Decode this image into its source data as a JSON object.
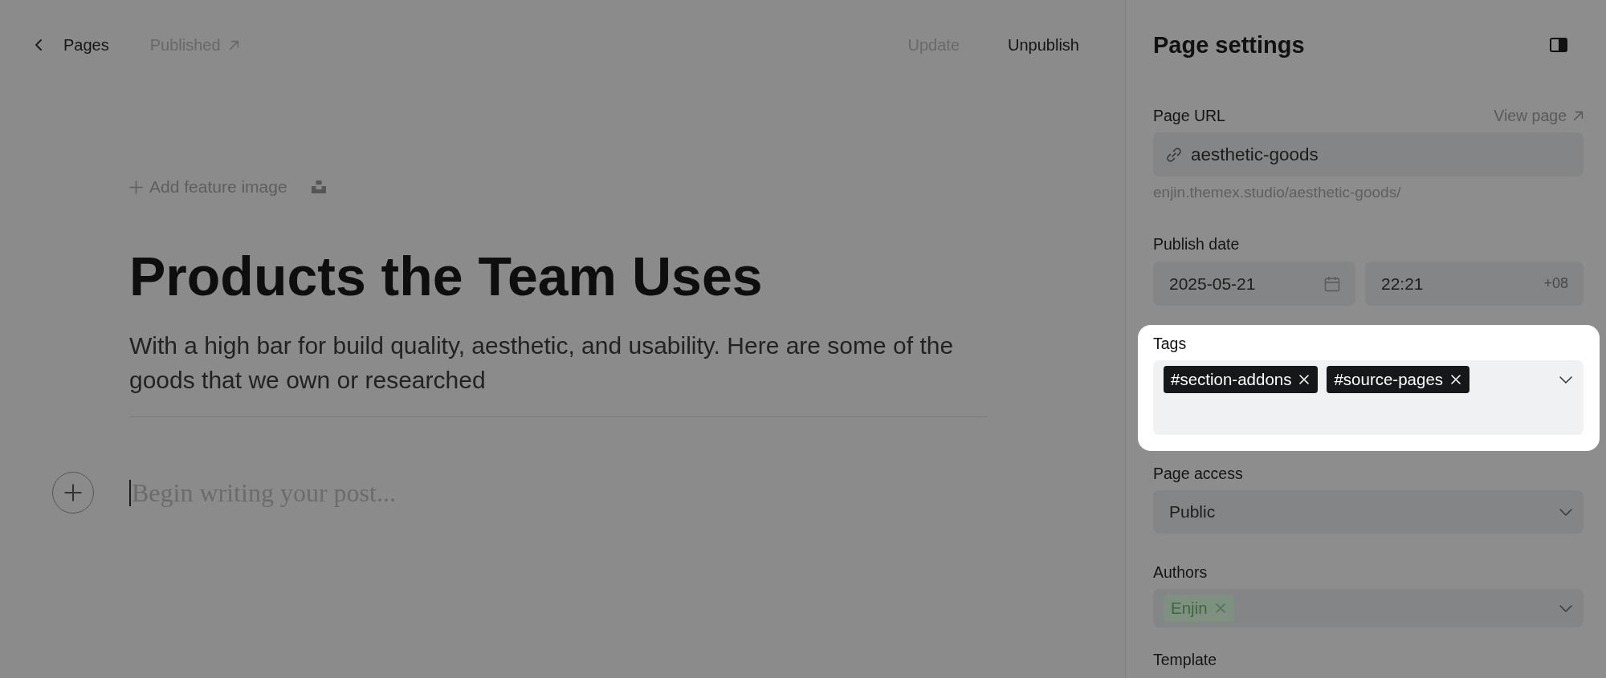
{
  "topbar": {
    "back_link": {
      "label": "Pages"
    },
    "status_link": {
      "label": "Published"
    },
    "actions": [
      {
        "label": "Update",
        "disabled": true
      },
      {
        "label": "Unpublish",
        "disabled": false
      }
    ]
  },
  "editor": {
    "feature_image_button": {
      "label": "Add feature image"
    },
    "title": "Products the Team Uses",
    "excerpt": "With a high bar for build quality, aesthetic, and usability. Here are some of the goods that we own or researched",
    "body": {
      "placeholder": "Begin writing your post..."
    }
  },
  "settings": {
    "title": "Page settings",
    "fields": [
      {
        "kind": "url",
        "label": "Page URL",
        "highlighted": false,
        "link": "View page",
        "value": "aesthetic-goods",
        "hint": "enjin.themex.studio/aesthetic-goods/"
      },
      {
        "kind": "datetime",
        "label": "Publish date",
        "highlighted": false,
        "date": "2025-05-21",
        "time": "22:21",
        "timezone": "+08"
      },
      {
        "kind": "tags",
        "label": "Tags",
        "highlighted": true,
        "tags": [
          {
            "label": "#section-addons"
          },
          {
            "label": "#source-pages"
          }
        ]
      },
      {
        "kind": "select",
        "label": "Page access",
        "highlighted": false,
        "value": "Public"
      },
      {
        "kind": "authors",
        "label": "Authors",
        "highlighted": false,
        "authors": [
          {
            "label": "Enjin"
          }
        ]
      },
      {
        "kind": "heading",
        "label": "Template",
        "highlighted": false
      }
    ]
  }
}
